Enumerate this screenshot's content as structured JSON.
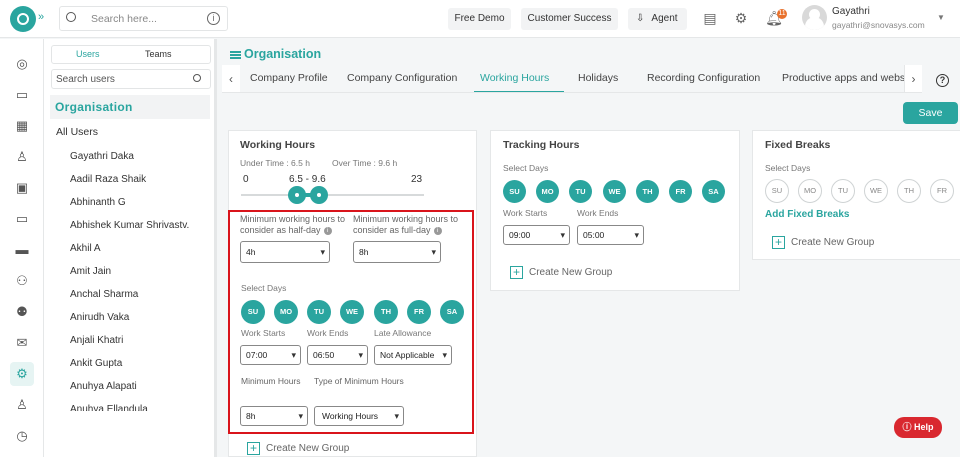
{
  "topbar": {
    "search_placeholder": "Search here...",
    "free_demo": "Free Demo",
    "customer_success": "Customer Success",
    "agent": "Agent",
    "notification_count": "11",
    "user_name": "Gayathri",
    "user_email": "gayathri@snovasys.com"
  },
  "sidebar": {
    "tabs": [
      "Users",
      "Teams"
    ],
    "search_placeholder": "Search users",
    "org": "Organisation",
    "all_users": "All Users",
    "users": [
      "Gayathri Daka",
      "Aadil Raza Shaik",
      "Abhinanth G",
      "Abhishek Kumar Shrivastv...",
      "Akhil A",
      "Amit Jain",
      "Anchal Sharma",
      "Anirudh Vaka",
      "Anjali Khatri",
      "Ankit Gupta",
      "Anuhya Alapati",
      "Anuhya Ellandula"
    ]
  },
  "breadcrumb": "Organisation",
  "tabs": [
    "Company Profile",
    "Company Configuration",
    "Working Hours",
    "Holidays",
    "Recording Configuration",
    "Productive apps and websites"
  ],
  "save_label": "Save",
  "working_hours": {
    "title": "Working Hours",
    "under_time": "Under Time : 6.5 h",
    "over_time": "Over Time : 9.6 h",
    "slider_min": "0",
    "slider_range": "6.5 - 9.6",
    "slider_max": "23",
    "half_day_label": "Minimum working hours to consider as half-day",
    "half_day_value": "4h",
    "full_day_label": "Minimum working hours to consider as full-day",
    "full_day_value": "8h",
    "select_days": "Select Days",
    "days": [
      "SU",
      "MO",
      "TU",
      "WE",
      "TH",
      "FR",
      "SA"
    ],
    "work_starts_label": "Work Starts",
    "work_starts": "07:00",
    "work_ends_label": "Work Ends",
    "work_ends": "06:50",
    "late_allowance_label": "Late Allowance",
    "late_allowance": "Not Applicable",
    "min_hours_label": "Minimum Hours",
    "min_hours": "8h",
    "type_min_label": "Type of Minimum Hours",
    "type_min": "Working Hours",
    "create_group": "Create New Group"
  },
  "tracking_hours": {
    "title": "Tracking Hours",
    "select_days": "Select Days",
    "days": [
      "SU",
      "MO",
      "TU",
      "WE",
      "TH",
      "FR",
      "SA"
    ],
    "work_starts_label": "Work Starts",
    "work_starts": "09:00",
    "work_ends_label": "Work Ends",
    "work_ends": "05:00",
    "create_group": "Create New Group"
  },
  "fixed_breaks": {
    "title": "Fixed Breaks",
    "select_days": "Select Days",
    "days": [
      "SU",
      "MO",
      "TU",
      "WE",
      "TH",
      "FR"
    ],
    "add_label": "Add Fixed Breaks",
    "create_group": "Create New Group"
  },
  "help_label": "Help"
}
